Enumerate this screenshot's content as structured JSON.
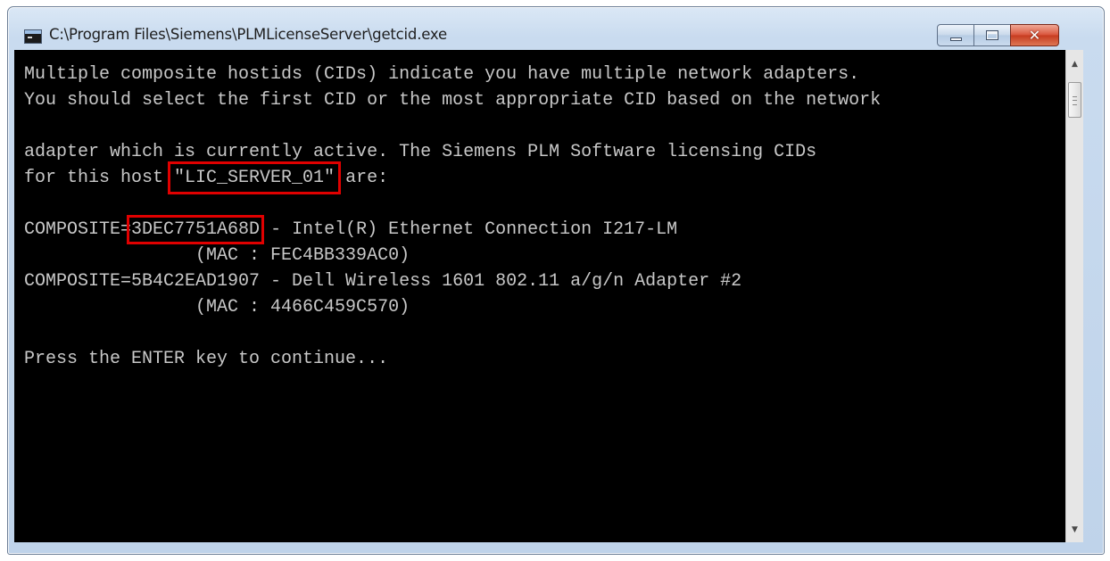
{
  "window": {
    "title": "C:\\Program Files\\Siemens\\PLMLicenseServer\\getcid.exe",
    "icon": "console-window-icon",
    "controls": {
      "minimize": "minimize-icon",
      "maximize": "maximize-icon",
      "close": "close-icon",
      "close_glyph": "✕"
    }
  },
  "console": {
    "line1": "Multiple composite hostids (CIDs) indicate you have multiple network adapters.",
    "line2": "You should select the first CID or the most appropriate CID based on the network",
    "line3": "adapter which is currently active. The Siemens PLM Software licensing CIDs",
    "line4_prefix": "for this host ",
    "host_name": "\"LIC_SERVER_01\"",
    "line4_suffix": " are:",
    "cid1_prefix": "COMPOSITE=",
    "cid1_value": "3DEC7751A68D",
    "cid1_desc": " - Intel(R) Ethernet Connection I217-LM",
    "cid1_mac": "                (MAC : FEC4BB339AC0)",
    "cid2_line": "COMPOSITE=5B4C2EAD1907 - Dell Wireless 1601 802.11 a/g/n Adapter #2",
    "cid2_mac": "                (MAC : 4466C459C570)",
    "prompt": "Press the ENTER key to continue..."
  },
  "scrollbar": {
    "up_arrow": "▲",
    "down_arrow": "▼"
  },
  "colors": {
    "console_bg": "#000000",
    "console_text": "#c8c8c8",
    "highlight_box": "#e00000",
    "close_button": "#c63b1f"
  }
}
